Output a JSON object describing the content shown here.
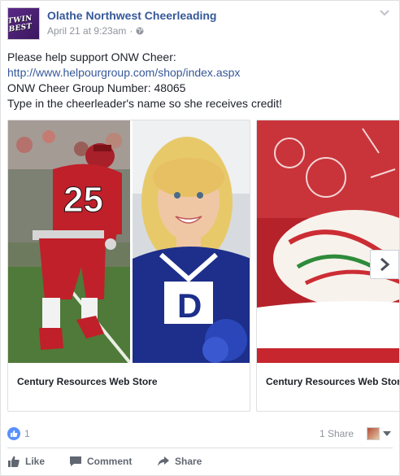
{
  "post": {
    "page_name": "Olathe Northwest Cheerleading",
    "avatar_text": "TWIN BEST",
    "timestamp": "April 21 at 9:23am",
    "meta_separator": "·",
    "lines": {
      "line1": "Please help support ONW Cheer:",
      "link": "http://www.helpourgroup.com/shop/index.aspx",
      "line3": "ONW Cheer Group Number: 48065",
      "line4": "Type in the cheerleader's name so she receives credit!"
    }
  },
  "carousel": {
    "items": [
      {
        "caption": "Century Resources Web Store",
        "jersey_number": "25",
        "cheer_letter": "D"
      },
      {
        "caption": "Century Resources Web Store"
      }
    ]
  },
  "stats": {
    "likes": "1",
    "shares": "1 Share"
  },
  "actions": {
    "like": "Like",
    "comment": "Comment",
    "share": "Share"
  },
  "colors": {
    "link": "#365899",
    "muted": "#90949c",
    "like_blue": "#5890ff",
    "jersey_red": "#c0202a",
    "cheer_blue": "#1d2f8a"
  }
}
